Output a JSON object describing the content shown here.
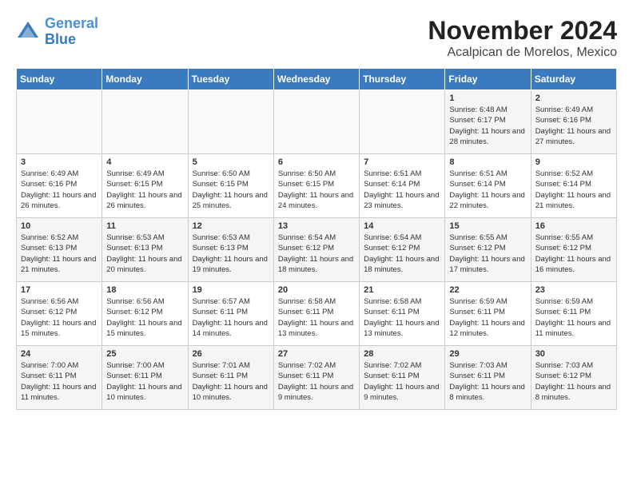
{
  "header": {
    "logo_line1": "General",
    "logo_line2": "Blue",
    "title": "November 2024",
    "subtitle": "Acalpican de Morelos, Mexico"
  },
  "days_of_week": [
    "Sunday",
    "Monday",
    "Tuesday",
    "Wednesday",
    "Thursday",
    "Friday",
    "Saturday"
  ],
  "weeks": [
    [
      {
        "day": "",
        "info": ""
      },
      {
        "day": "",
        "info": ""
      },
      {
        "day": "",
        "info": ""
      },
      {
        "day": "",
        "info": ""
      },
      {
        "day": "",
        "info": ""
      },
      {
        "day": "1",
        "info": "Sunrise: 6:48 AM\nSunset: 6:17 PM\nDaylight: 11 hours and 28 minutes."
      },
      {
        "day": "2",
        "info": "Sunrise: 6:49 AM\nSunset: 6:16 PM\nDaylight: 11 hours and 27 minutes."
      }
    ],
    [
      {
        "day": "3",
        "info": "Sunrise: 6:49 AM\nSunset: 6:16 PM\nDaylight: 11 hours and 26 minutes."
      },
      {
        "day": "4",
        "info": "Sunrise: 6:49 AM\nSunset: 6:15 PM\nDaylight: 11 hours and 26 minutes."
      },
      {
        "day": "5",
        "info": "Sunrise: 6:50 AM\nSunset: 6:15 PM\nDaylight: 11 hours and 25 minutes."
      },
      {
        "day": "6",
        "info": "Sunrise: 6:50 AM\nSunset: 6:15 PM\nDaylight: 11 hours and 24 minutes."
      },
      {
        "day": "7",
        "info": "Sunrise: 6:51 AM\nSunset: 6:14 PM\nDaylight: 11 hours and 23 minutes."
      },
      {
        "day": "8",
        "info": "Sunrise: 6:51 AM\nSunset: 6:14 PM\nDaylight: 11 hours and 22 minutes."
      },
      {
        "day": "9",
        "info": "Sunrise: 6:52 AM\nSunset: 6:14 PM\nDaylight: 11 hours and 21 minutes."
      }
    ],
    [
      {
        "day": "10",
        "info": "Sunrise: 6:52 AM\nSunset: 6:13 PM\nDaylight: 11 hours and 21 minutes."
      },
      {
        "day": "11",
        "info": "Sunrise: 6:53 AM\nSunset: 6:13 PM\nDaylight: 11 hours and 20 minutes."
      },
      {
        "day": "12",
        "info": "Sunrise: 6:53 AM\nSunset: 6:13 PM\nDaylight: 11 hours and 19 minutes."
      },
      {
        "day": "13",
        "info": "Sunrise: 6:54 AM\nSunset: 6:12 PM\nDaylight: 11 hours and 18 minutes."
      },
      {
        "day": "14",
        "info": "Sunrise: 6:54 AM\nSunset: 6:12 PM\nDaylight: 11 hours and 18 minutes."
      },
      {
        "day": "15",
        "info": "Sunrise: 6:55 AM\nSunset: 6:12 PM\nDaylight: 11 hours and 17 minutes."
      },
      {
        "day": "16",
        "info": "Sunrise: 6:55 AM\nSunset: 6:12 PM\nDaylight: 11 hours and 16 minutes."
      }
    ],
    [
      {
        "day": "17",
        "info": "Sunrise: 6:56 AM\nSunset: 6:12 PM\nDaylight: 11 hours and 15 minutes."
      },
      {
        "day": "18",
        "info": "Sunrise: 6:56 AM\nSunset: 6:12 PM\nDaylight: 11 hours and 15 minutes."
      },
      {
        "day": "19",
        "info": "Sunrise: 6:57 AM\nSunset: 6:11 PM\nDaylight: 11 hours and 14 minutes."
      },
      {
        "day": "20",
        "info": "Sunrise: 6:58 AM\nSunset: 6:11 PM\nDaylight: 11 hours and 13 minutes."
      },
      {
        "day": "21",
        "info": "Sunrise: 6:58 AM\nSunset: 6:11 PM\nDaylight: 11 hours and 13 minutes."
      },
      {
        "day": "22",
        "info": "Sunrise: 6:59 AM\nSunset: 6:11 PM\nDaylight: 11 hours and 12 minutes."
      },
      {
        "day": "23",
        "info": "Sunrise: 6:59 AM\nSunset: 6:11 PM\nDaylight: 11 hours and 11 minutes."
      }
    ],
    [
      {
        "day": "24",
        "info": "Sunrise: 7:00 AM\nSunset: 6:11 PM\nDaylight: 11 hours and 11 minutes."
      },
      {
        "day": "25",
        "info": "Sunrise: 7:00 AM\nSunset: 6:11 PM\nDaylight: 11 hours and 10 minutes."
      },
      {
        "day": "26",
        "info": "Sunrise: 7:01 AM\nSunset: 6:11 PM\nDaylight: 11 hours and 10 minutes."
      },
      {
        "day": "27",
        "info": "Sunrise: 7:02 AM\nSunset: 6:11 PM\nDaylight: 11 hours and 9 minutes."
      },
      {
        "day": "28",
        "info": "Sunrise: 7:02 AM\nSunset: 6:11 PM\nDaylight: 11 hours and 9 minutes."
      },
      {
        "day": "29",
        "info": "Sunrise: 7:03 AM\nSunset: 6:11 PM\nDaylight: 11 hours and 8 minutes."
      },
      {
        "day": "30",
        "info": "Sunrise: 7:03 AM\nSunset: 6:12 PM\nDaylight: 11 hours and 8 minutes."
      }
    ]
  ]
}
